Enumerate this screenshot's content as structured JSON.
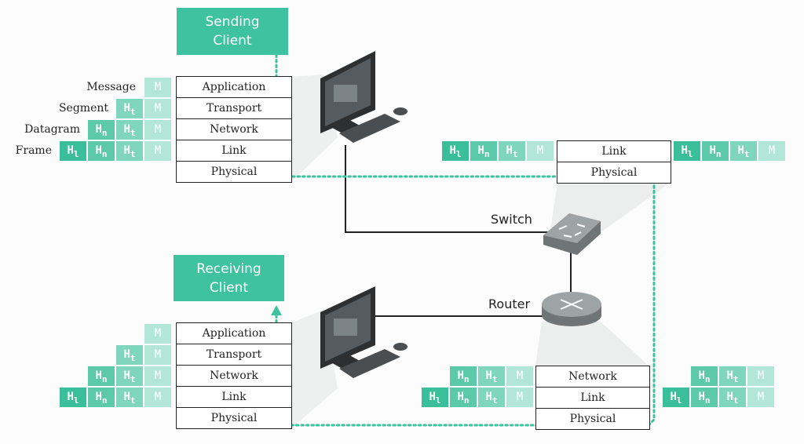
{
  "sending_client": {
    "title": "Sending\nClient",
    "layers": [
      "Application",
      "Transport",
      "Network",
      "Link",
      "Physical"
    ],
    "packet_labels": [
      "Message",
      "Segment",
      "Datagram",
      "Frame"
    ]
  },
  "receiving_client": {
    "title": "Receiving\nClient",
    "layers": [
      "Application",
      "Transport",
      "Network",
      "Link",
      "Physical"
    ]
  },
  "switch": {
    "label": "Switch",
    "layers": [
      "Link",
      "Physical"
    ]
  },
  "router": {
    "label": "Router",
    "layers": [
      "Network",
      "Link",
      "Physical"
    ]
  },
  "headers": {
    "link": "H",
    "link_sub": "l",
    "network": "H",
    "network_sub": "n",
    "transport": "H",
    "transport_sub": "t",
    "message": "M"
  },
  "colors": {
    "accent": "#3fc29f",
    "link_header": "#3bbf9b",
    "network_header": "#5ccaa9",
    "transport_header": "#80d6bd",
    "message": "#b2e6d7",
    "path": "#3fc29f"
  }
}
